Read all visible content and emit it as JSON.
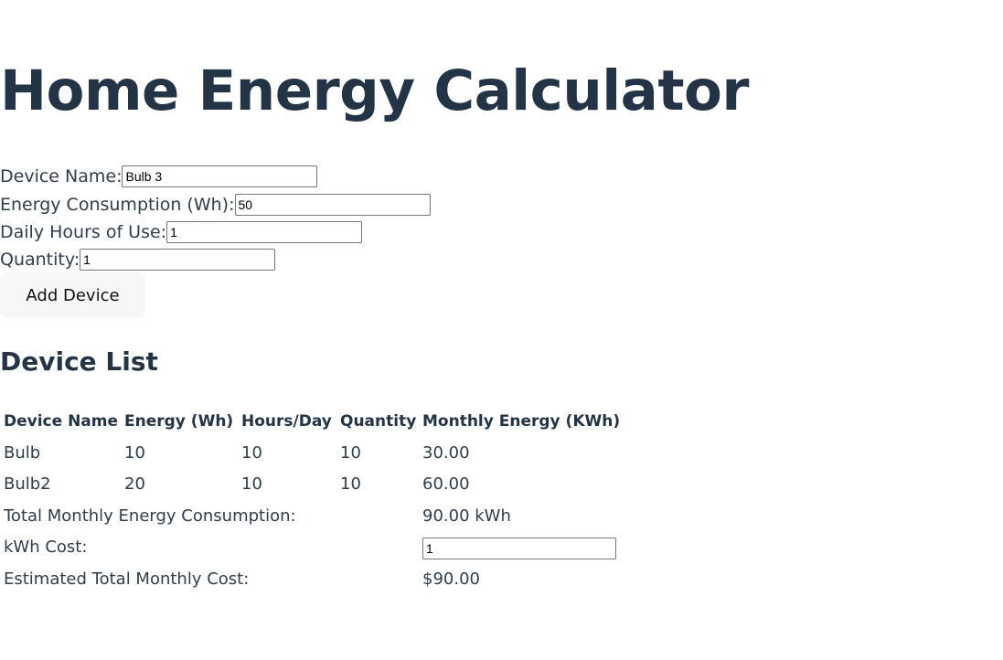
{
  "page": {
    "title": "Home Energy Calculator"
  },
  "form": {
    "device_name_label": "Device Name:",
    "device_name_value": "Bulb 3",
    "energy_label": "Energy Consumption (Wh):",
    "energy_value": "50",
    "hours_label": "Daily Hours of Use:",
    "hours_value": "1",
    "quantity_label": "Quantity:",
    "quantity_value": "1",
    "add_button_label": "Add Device"
  },
  "device_list": {
    "title": "Device List",
    "headers": [
      "Device Name",
      "Energy (Wh)",
      "Hours/Day",
      "Quantity",
      "Monthly Energy (KWh)"
    ],
    "rows": [
      [
        "Bulb",
        "10",
        "10",
        "10",
        "30.00"
      ],
      [
        "Bulb2",
        "20",
        "10",
        "10",
        "60.00"
      ]
    ],
    "total_label": "Total Monthly Energy Consumption:",
    "total_value": "90.00 kWh",
    "cost_label": "kWh Cost:",
    "cost_value": "1",
    "estimated_label": "Estimated Total Monthly Cost:",
    "estimated_value": "$90.00"
  }
}
